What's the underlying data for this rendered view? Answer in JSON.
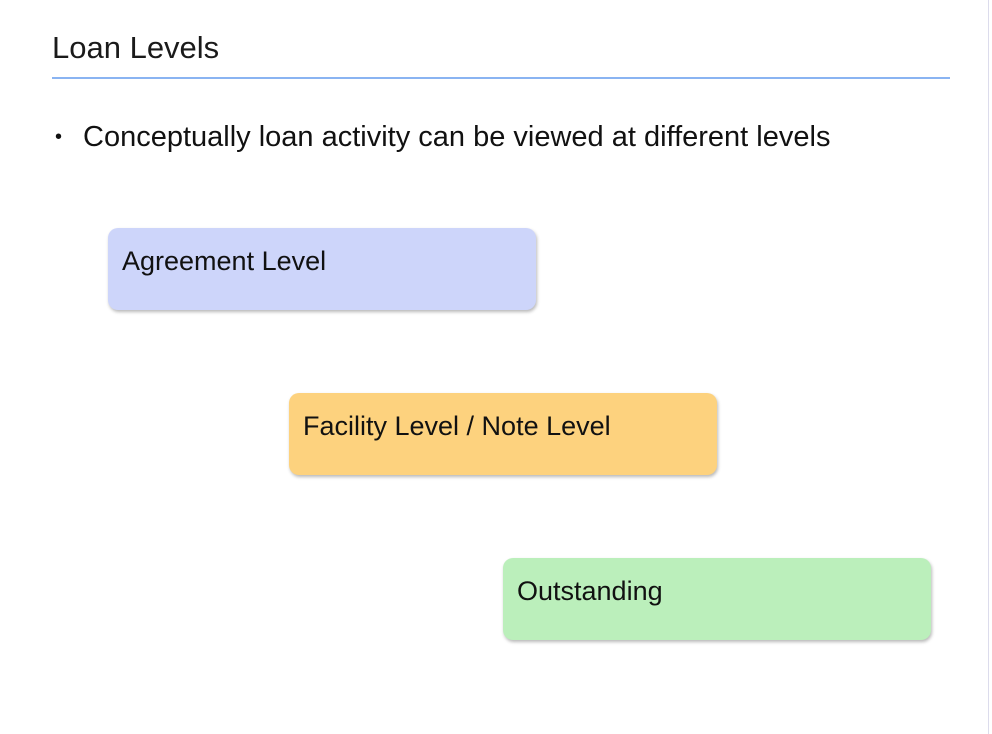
{
  "slide": {
    "title": "Loan Levels",
    "bullets": [
      "Conceptually loan activity can be viewed at different levels"
    ],
    "bullet_glyph": "•"
  },
  "levels": [
    {
      "label": "Agreement Level",
      "color": "#cdd5fa"
    },
    {
      "label": "Facility Level / Note Level",
      "color": "#fdd27e"
    },
    {
      "label": "Outstanding",
      "color": "#bbefbb"
    }
  ],
  "colors": {
    "title_rule": "#8ab4f2"
  }
}
